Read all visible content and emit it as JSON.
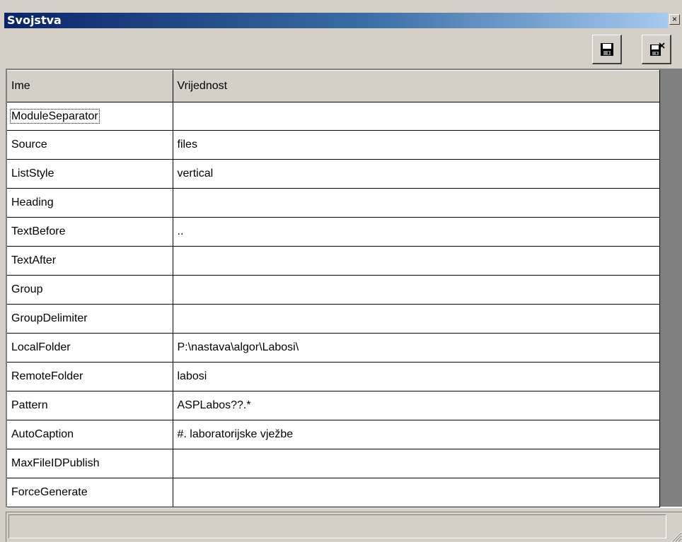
{
  "window": {
    "title": "Svojstva",
    "close_symbol": "×",
    "colors": {
      "face": "#d4d0c8",
      "title_start": "#0a246a",
      "title_end": "#a6caf0"
    }
  },
  "toolbar": {
    "save_icon": "floppy-disk-icon",
    "save_close_icon": "floppy-disk-close-icon"
  },
  "grid": {
    "headers": {
      "name": "Ime",
      "value": "Vrijednost"
    },
    "rows": [
      {
        "name": "ModuleSeparator",
        "value": ""
      },
      {
        "name": "Source",
        "value": "files"
      },
      {
        "name": "ListStyle",
        "value": "vertical"
      },
      {
        "name": "Heading",
        "value": ""
      },
      {
        "name": "TextBefore",
        "value": ".."
      },
      {
        "name": "TextAfter",
        "value": ""
      },
      {
        "name": "Group",
        "value": ""
      },
      {
        "name": "GroupDelimiter",
        "value": ""
      },
      {
        "name": "LocalFolder",
        "value": "P:\\nastava\\algor\\Labosi\\"
      },
      {
        "name": "RemoteFolder",
        "value": "labosi"
      },
      {
        "name": "Pattern",
        "value": "ASPLabos??.*"
      },
      {
        "name": "AutoCaption",
        "value": "#. laboratorijske vježbe"
      },
      {
        "name": "MaxFileIDPublish",
        "value": ""
      },
      {
        "name": "ForceGenerate",
        "value": ""
      }
    ]
  },
  "statusbar": {
    "text": ""
  }
}
